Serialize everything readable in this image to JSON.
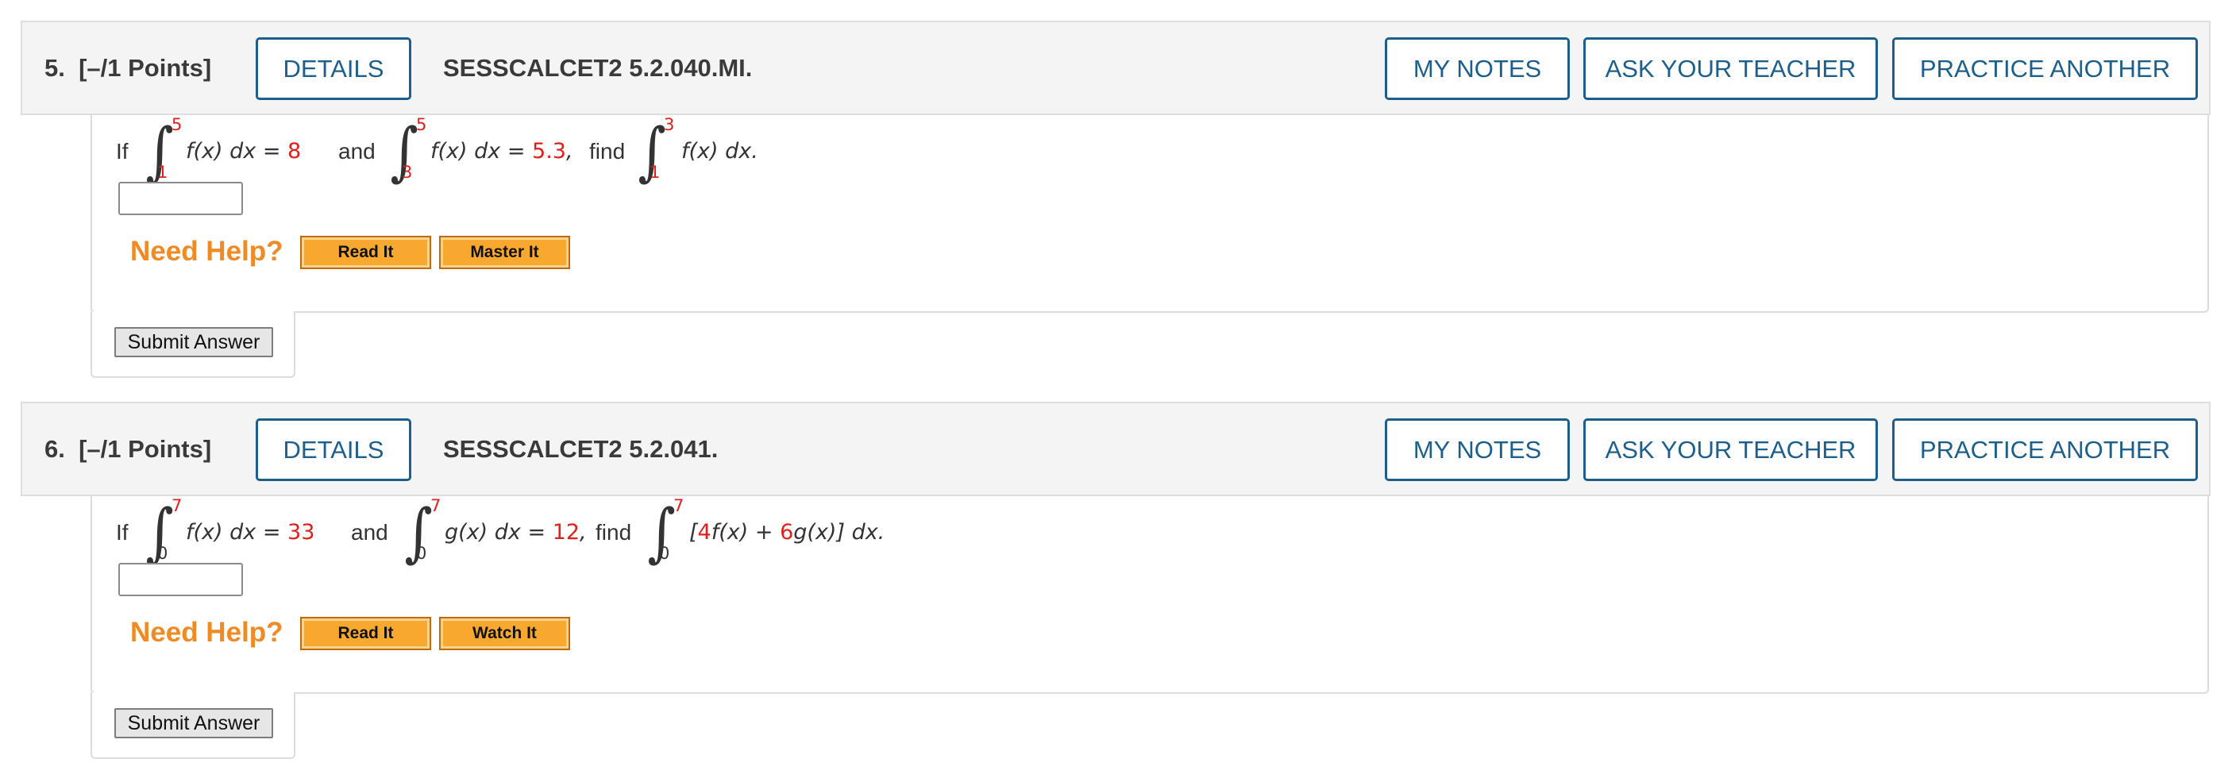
{
  "q5": {
    "number": "5.",
    "points": "[–/1 Points]",
    "details_label": "DETAILS",
    "code": "SESSCALCET2 5.2.040.MI.",
    "my_notes_label": "MY NOTES",
    "ask_teacher_label": "ASK YOUR TEACHER",
    "practice_another_label": "PRACTICE ANOTHER",
    "text": {
      "if": "If",
      "int1_upper": "5",
      "int1_lower": "1",
      "int1_expr": "f(x) dx = ",
      "int1_value": "8",
      "and": "and",
      "int2_upper": "5",
      "int2_lower": "3",
      "int2_expr": "f(x) dx = ",
      "int2_value": "5.3",
      "comma": ",",
      "find": "find",
      "int3_upper": "3",
      "int3_lower": "1",
      "int3_expr": "f(x) dx."
    },
    "answer_value": "",
    "need_help": "Need Help?",
    "help_buttons": [
      "Read It",
      "Master It"
    ],
    "submit_label": "Submit Answer"
  },
  "q6": {
    "number": "6.",
    "points": "[–/1 Points]",
    "details_label": "DETAILS",
    "code": "SESSCALCET2 5.2.041.",
    "my_notes_label": "MY NOTES",
    "ask_teacher_label": "ASK YOUR TEACHER",
    "practice_another_label": "PRACTICE ANOTHER",
    "text": {
      "if": "If",
      "int1_upper": "7",
      "int1_lower": "0",
      "int1_expr": "f(x) dx = ",
      "int1_value": "33",
      "and": "and",
      "int2_upper": "7",
      "int2_lower": "0",
      "int2_expr": "g(x) dx = ",
      "int2_value": "12",
      "comma": ",",
      "find": "find",
      "int3_upper": "7",
      "int3_lower": "0",
      "int3_open": "[",
      "int3_coef1": "4",
      "int3_mid": "f(x) + ",
      "int3_coef2": "6",
      "int3_end": "g(x)] dx."
    },
    "answer_value": "",
    "need_help": "Need Help?",
    "help_buttons": [
      "Read It",
      "Watch It"
    ],
    "submit_label": "Submit Answer"
  },
  "colors": {
    "link_blue": "#1c5f8c",
    "value_red": "#e0201c",
    "need_help_orange": "#f08a24",
    "help_button_orange": "#f7a82f"
  }
}
